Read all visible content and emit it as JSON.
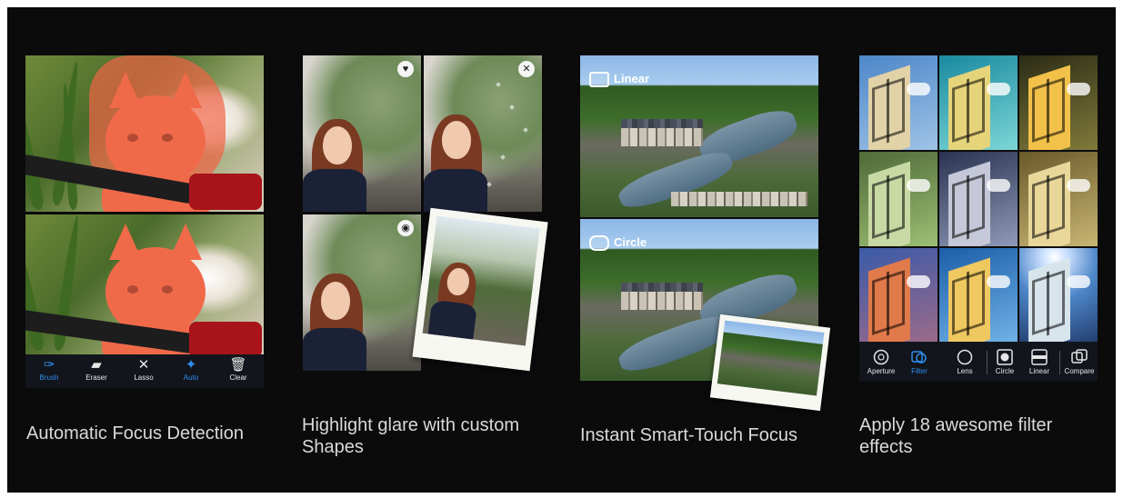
{
  "panels": [
    {
      "caption": "Automatic Focus Detection"
    },
    {
      "caption": "Highlight glare with custom Shapes"
    },
    {
      "caption": "Instant Smart-Touch Focus"
    },
    {
      "caption": "Apply 18 awesome filter effects"
    }
  ],
  "panel1_toolbar": [
    {
      "label": "Brush",
      "icon": "brush-icon",
      "active": true
    },
    {
      "label": "Eraser",
      "icon": "eraser-icon",
      "active": false
    },
    {
      "label": "Lasso",
      "icon": "lasso-icon",
      "active": false
    },
    {
      "label": "Auto",
      "icon": "magic-wand-icon",
      "active": true
    },
    {
      "label": "Clear",
      "icon": "trash-icon",
      "active": false
    }
  ],
  "panel2_icons": [
    "heart-icon",
    "close-icon",
    "target-icon"
  ],
  "panel3_labels": {
    "top": "Linear",
    "bottom": "Circle"
  },
  "panel4_toolbar": [
    {
      "label": "Aperture",
      "icon": "aperture-icon",
      "active": false
    },
    {
      "label": "Filter",
      "icon": "filter-icon",
      "active": true
    },
    {
      "label": "Lens",
      "icon": "lens-icon",
      "active": false
    },
    {
      "label": "Circle",
      "icon": "circle-shape-icon",
      "active": false
    },
    {
      "label": "Linear",
      "icon": "linear-shape-icon",
      "active": false
    },
    {
      "label": "Compare",
      "icon": "compare-icon",
      "active": false
    }
  ],
  "colors": {
    "background": "#0b0b0b",
    "caption_text": "#d9d9d9",
    "accent_blue": "#2f8ff0",
    "mask_orange": "#f06a4a"
  }
}
